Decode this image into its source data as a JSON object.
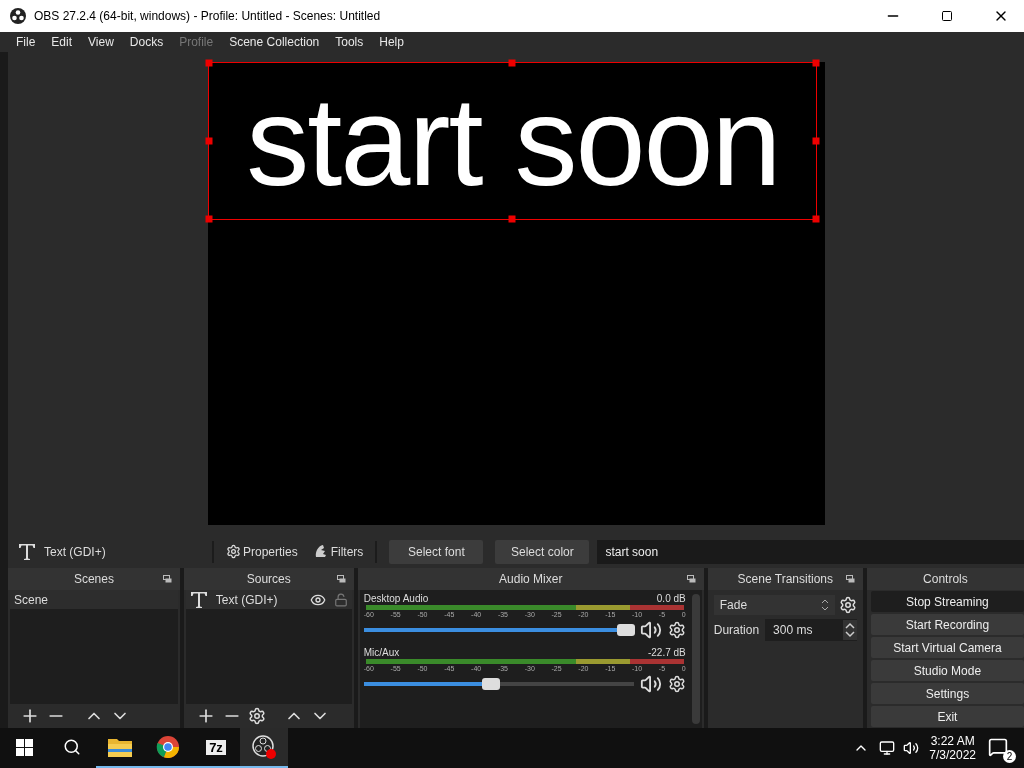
{
  "window": {
    "title": "OBS 27.2.4 (64-bit, windows) - Profile: Untitled - Scenes: Untitled"
  },
  "menu": [
    {
      "label": "File",
      "disabled": false
    },
    {
      "label": "Edit",
      "disabled": false
    },
    {
      "label": "View",
      "disabled": false
    },
    {
      "label": "Docks",
      "disabled": false
    },
    {
      "label": "Profile",
      "disabled": true
    },
    {
      "label": "Scene Collection",
      "disabled": false
    },
    {
      "label": "Tools",
      "disabled": false
    },
    {
      "label": "Help",
      "disabled": false
    }
  ],
  "preview": {
    "text": "start soon",
    "selected": true
  },
  "source_toolbar": {
    "source": "Text (GDI+)",
    "properties": "Properties",
    "filters": "Filters",
    "buttons": [
      "Select font",
      "Select color"
    ],
    "text_value": "start soon"
  },
  "scenes": {
    "title": "Scenes",
    "items": [
      {
        "label": "Scene",
        "selected": true
      }
    ]
  },
  "sources": {
    "title": "Sources",
    "items": [
      {
        "label": "Text (GDI+)",
        "selected": true,
        "visible": true,
        "locked": false
      }
    ]
  },
  "audio_mixer": {
    "title": "Audio Mixer",
    "channels": [
      {
        "name": "Desktop Audio",
        "reading": "0.0 dB",
        "level": 0.97,
        "ticks": [
          "-60",
          "-55",
          "-50",
          "-45",
          "-40",
          "-35",
          "-30",
          "-25",
          "-20",
          "-15",
          "-10",
          "-5",
          "0"
        ]
      },
      {
        "name": "Mic/Aux",
        "reading": "-22.7 dB",
        "level": 0.47,
        "ticks": [
          "-60",
          "-55",
          "-50",
          "-45",
          "-40",
          "-35",
          "-30",
          "-25",
          "-20",
          "-15",
          "-10",
          "-5",
          "0"
        ]
      }
    ]
  },
  "scene_transitions": {
    "title": "Scene Transitions",
    "transition": "Fade",
    "duration_label": "Duration",
    "duration": "300 ms"
  },
  "controls": {
    "title": "Controls",
    "buttons": [
      {
        "label": "Stop Streaming",
        "active": true
      },
      {
        "label": "Start Recording",
        "active": false
      },
      {
        "label": "Start Virtual Camera",
        "active": false
      },
      {
        "label": "Studio Mode",
        "active": false
      },
      {
        "label": "Settings",
        "active": false
      },
      {
        "label": "Exit",
        "active": false
      }
    ]
  },
  "taskbar": {
    "apps": [
      {
        "kind": "folder",
        "running": true
      },
      {
        "kind": "browser",
        "running": true
      },
      {
        "kind": "archiver",
        "label": "7z",
        "running": true
      },
      {
        "kind": "obs",
        "running": true
      }
    ],
    "time": "3:22 AM",
    "date": "7/3/2022",
    "notifications": "2"
  }
}
